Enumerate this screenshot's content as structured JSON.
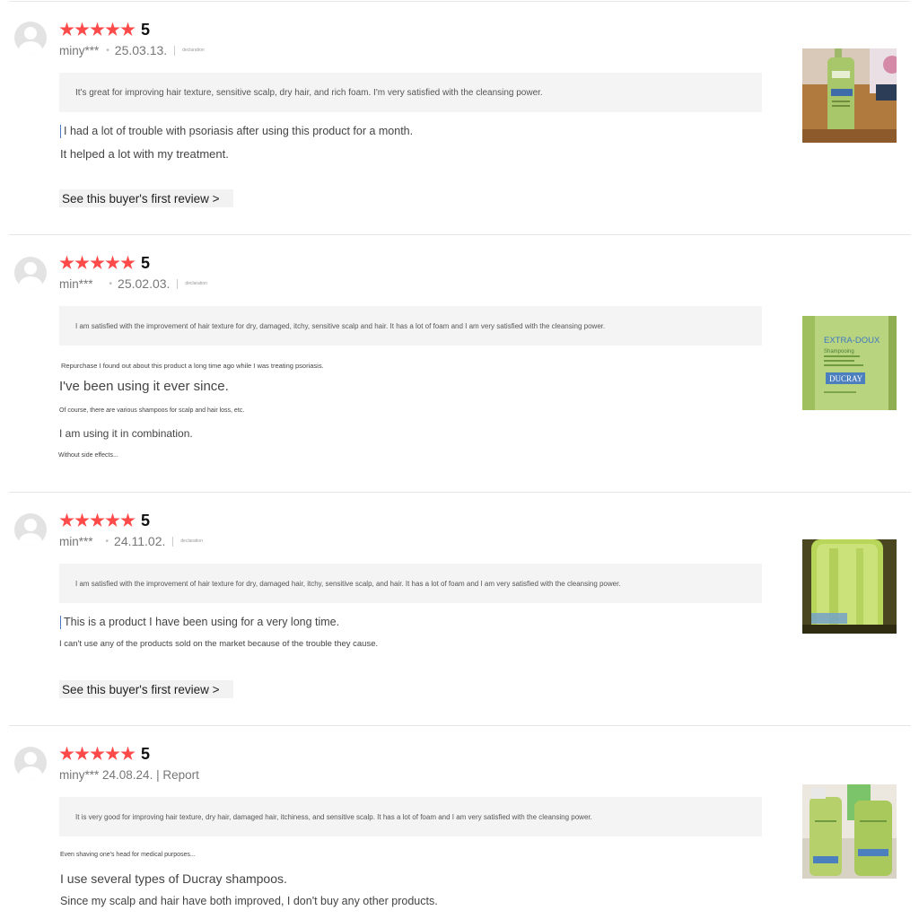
{
  "reviews": [
    {
      "rating": 5,
      "user": "miny***",
      "date": "25.03.13.",
      "report": "declaration",
      "summary": "It's great for improving hair texture, sensitive scalp, dry hair, and rich foam. I'm very satisfied with the cleansing power.",
      "lines": [
        "I had a lot of trouble with psoriasis after using this product for a month.",
        "It helped a lot with my treatment."
      ],
      "first_review": "See this buyer's first review >"
    },
    {
      "rating": 5,
      "user": "min***",
      "date": "25.02.03.",
      "report": "declaration",
      "summary": "I am satisfied with the improvement of hair texture for dry, damaged, itchy, sensitive scalp and hair. It has a lot of foam and I am very satisfied with the cleansing power.",
      "lines": [
        "Repurchase I found out about this product a long time ago while I was treating psoriasis.",
        "I've been using it ever since.",
        "Of course, there are various shampoos for scalp and hair loss, etc.",
        "I am using it in combination.",
        "Without side effects..."
      ],
      "photo_text": [
        "EXTRA-DOUX",
        "Shampooing",
        "DUCRAY"
      ]
    },
    {
      "rating": 5,
      "user": "min***",
      "date": "24.11.02.",
      "report": "declaration",
      "summary": "I am satisfied with the improvement of hair texture for dry, damaged hair, itchy, sensitive scalp, and hair. It has a lot of foam and I am very satisfied with the cleansing power.",
      "lines": [
        "This is a product I have been using for a very long time.",
        "I can't use any of the products sold on the market because of the trouble they cause."
      ],
      "first_review": "See this buyer's first review >"
    },
    {
      "rating": 5,
      "meta": "miny*** 24.08.24. | Report",
      "summary": "It is very good for improving hair texture, dry hair, damaged hair, itchiness, and sensitive scalp. It has a lot of foam and I am very satisfied with the cleansing power.",
      "lines": [
        "Even shaving one's head for medical purposes...",
        "I use several types of Ducray shampoos.",
        "Since my scalp and hair have both improved, I don't buy any other products."
      ]
    }
  ],
  "colors": {
    "star": "#ff4a4a",
    "summary_bg": "#f4f4f5",
    "divider": "#e6e6e6"
  }
}
